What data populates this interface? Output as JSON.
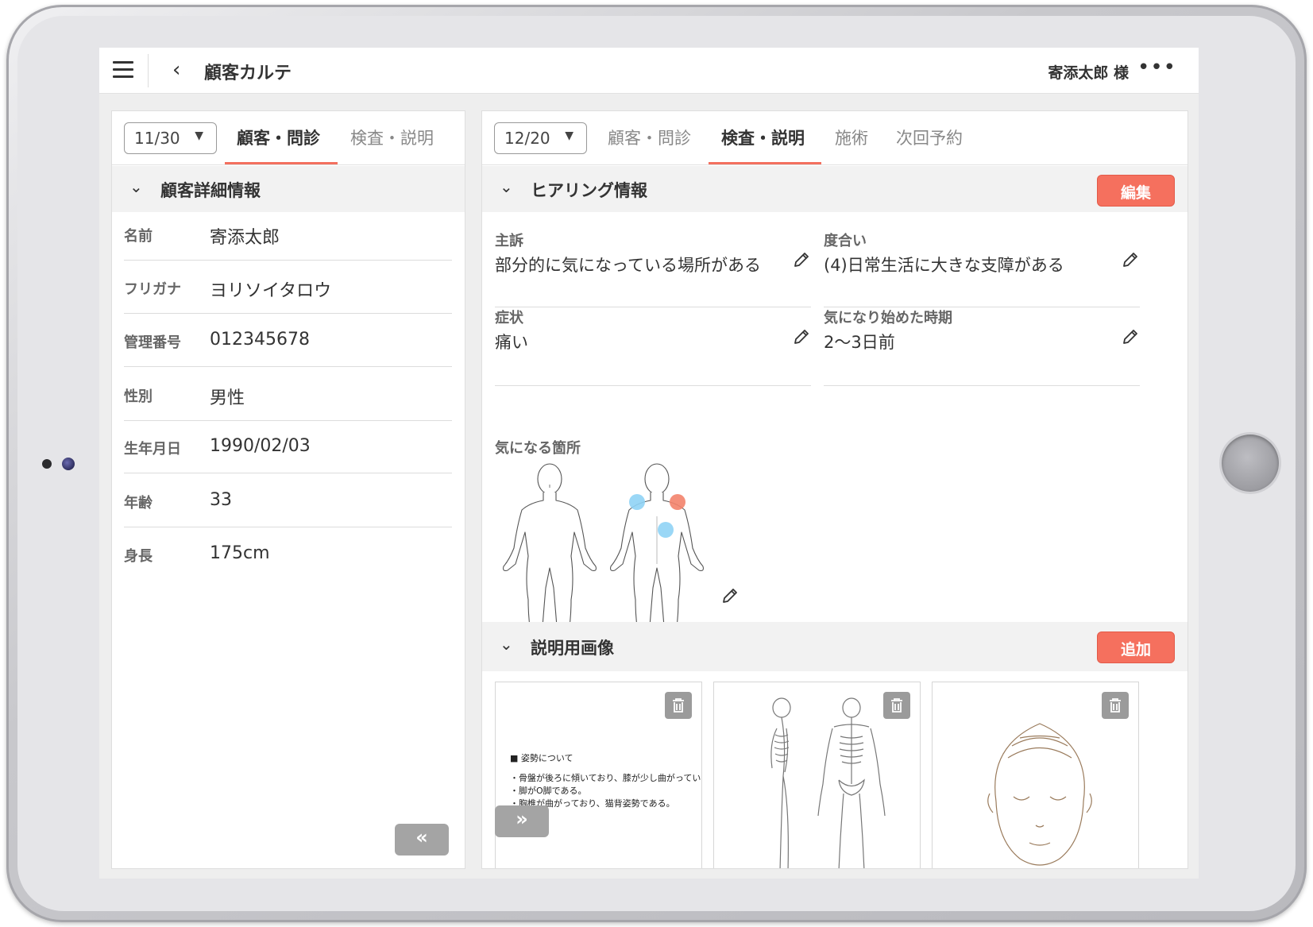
{
  "topbar": {
    "title": "顧客カルテ",
    "user": "寄添太郎 様"
  },
  "left_panel": {
    "date": "11/30",
    "tabs": [
      {
        "label": "顧客・問診",
        "active": true
      },
      {
        "label": "検査・説明",
        "active": false
      }
    ],
    "section_title": "顧客詳細情報",
    "rows": [
      {
        "label": "名前",
        "value": "寄添太郎"
      },
      {
        "label": "フリガナ",
        "value": "ヨリソイタロウ"
      },
      {
        "label": "管理番号",
        "value": "012345678"
      },
      {
        "label": "性別",
        "value": "男性"
      },
      {
        "label": "生年月日",
        "value": "1990/02/03"
      },
      {
        "label": "年齢",
        "value": "33"
      },
      {
        "label": "身長",
        "value": "175cm"
      }
    ],
    "collapse_icon": "double-chevron-left-icon"
  },
  "right_panel": {
    "date": "12/20",
    "tabs": [
      {
        "label": "顧客・問診",
        "active": false
      },
      {
        "label": "検査・説明",
        "active": true
      },
      {
        "label": "施術",
        "active": false
      },
      {
        "label": "次回予約",
        "active": false
      }
    ],
    "hearing": {
      "title": "ヒアリング情報",
      "edit_label": "編集",
      "fields": [
        {
          "label": "主訴",
          "value": "部分的に気になっている場所がある"
        },
        {
          "label": "度合い",
          "value": "(4)日常生活に大きな支障がある"
        },
        {
          "label": "症状",
          "value": "痛い"
        },
        {
          "label": "気になり始めた時期",
          "value": "2〜3日前"
        }
      ],
      "body_label": "気になる箇所",
      "marker_colors": {
        "blue": "#8fd3f5",
        "orange": "#f3836b"
      }
    },
    "images": {
      "title": "説明用画像",
      "add_label": "追加",
      "memo_lines": [
        "■ 姿勢について",
        "・骨盤が後ろに傾いており、膝が少し曲がっている。",
        "・脚がO脚である。",
        "・胸椎が曲がっており、猫背姿勢である。"
      ]
    }
  },
  "colors": {
    "accent": "#f5705e",
    "underline": "#f3705f"
  }
}
